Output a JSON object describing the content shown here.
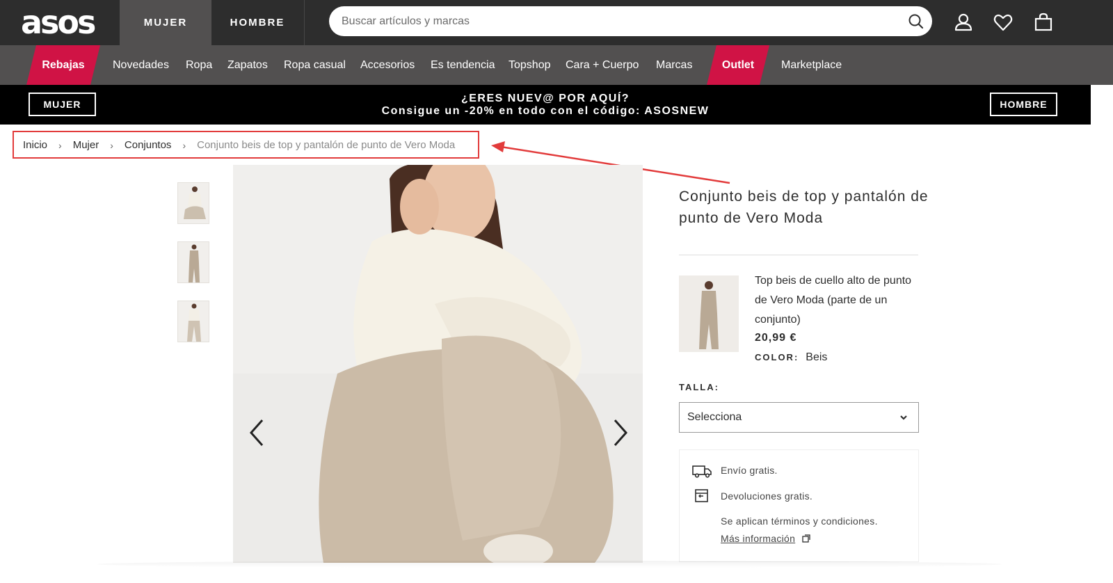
{
  "header": {
    "logo": "asos",
    "tabs": [
      {
        "label": "MUJER",
        "active": true
      },
      {
        "label": "HOMBRE",
        "active": false
      }
    ],
    "search": {
      "placeholder": "Buscar artículos y marcas",
      "value": ""
    },
    "icons": [
      "search-icon",
      "account-icon",
      "heart-icon",
      "bag-icon"
    ]
  },
  "category_nav": {
    "items": [
      {
        "label": "Rebajas",
        "highlight": true
      },
      {
        "label": "Novedades"
      },
      {
        "label": "Ropa"
      },
      {
        "label": "Zapatos"
      },
      {
        "label": "Ropa casual"
      },
      {
        "label": "Accesorios"
      },
      {
        "label": "Es tendencia"
      },
      {
        "label": "Topshop"
      },
      {
        "label": "Cara + Cuerpo"
      },
      {
        "label": "Marcas"
      },
      {
        "label": "Outlet",
        "highlight": true
      },
      {
        "label": "Marketplace"
      }
    ]
  },
  "promo": {
    "left_button": "MUJER",
    "line1": "¿ERES NUEV@ POR AQUÍ?",
    "line2": "Consigue un -20% en todo con el código: ASOSNEW",
    "right_button": "HOMBRE"
  },
  "breadcrumb": {
    "items": [
      "Inicio",
      "Mujer",
      "Conjuntos"
    ],
    "current": "Conjunto beis de top y pantalón de punto de Vero Moda",
    "separator": "›"
  },
  "product": {
    "title": "Conjunto beis de top y pantalón de punto de Vero Moda",
    "item": {
      "name": "Top beis de cuello alto de punto de Vero Moda (parte de un conjunto)",
      "price": "20,99 €",
      "color_label": "COLOR:",
      "color_value": "Beis"
    },
    "size": {
      "label": "TALLA:",
      "selected": "Selecciona"
    },
    "info": {
      "shipping": "Envío gratis.",
      "returns": "Devoluciones gratis.",
      "terms": "Se aplican términos y condiciones.",
      "more_link": "Más información"
    }
  },
  "colors": {
    "header_bg": "#2d2d2d",
    "nav_bg": "#525050",
    "accent_red": "#d01345",
    "annotation_red": "#e23b3b"
  }
}
